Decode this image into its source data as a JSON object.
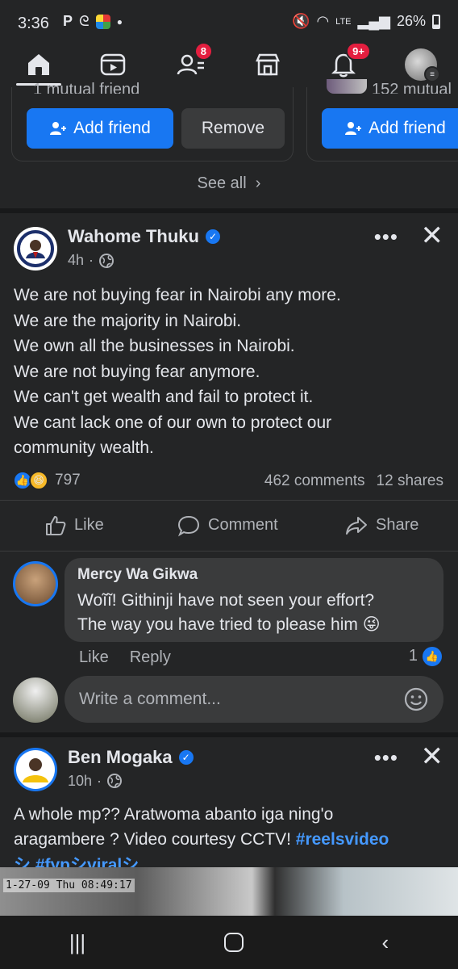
{
  "status_bar": {
    "time": "3:36",
    "left_glyphs": "P",
    "network": "LTE",
    "battery": "26%"
  },
  "nav": {
    "friends_badge": "8",
    "notifications_badge": "9+"
  },
  "suggestions": {
    "left_mutual": "1 mutual friend",
    "right_mutual": "152 mutual",
    "add_friend_label": "Add friend",
    "remove_label": "Remove",
    "see_all": "See all"
  },
  "post1": {
    "author": "Wahome Thuku",
    "time": "4h",
    "text_lines": [
      "We are not buying fear in Nairobi any more.",
      "We are the majority in Nairobi.",
      "We own all the businesses in Nairobi.",
      "We are not buying fear anymore.",
      "We can't get wealth and fail to protect it.",
      "We cant lack one of our own to protect our",
      "community wealth."
    ],
    "reaction_count": "797",
    "comments": "462 comments",
    "shares": "12 shares",
    "like_label": "Like",
    "comment_label": "Comment",
    "share_label": "Share",
    "avatar_text": "WAHOME THUKU MEDIA"
  },
  "comment": {
    "author": "Mercy Wa Gikwa",
    "line1": "Woĩĩ! Githinji have not seen your effort?",
    "line2": "The way you have tried to please him 😜",
    "like": "Like",
    "reply": "Reply",
    "likes": "1"
  },
  "write_comment": {
    "placeholder": "Write a comment..."
  },
  "post2": {
    "author": "Ben Mogaka",
    "time": "10h",
    "line1": "A whole mp?? Aratwoma abanto iga ning'o",
    "line2_plain": "aragambere ? Video courtesy CCTV! ",
    "line2_tag": "#reelsvideo",
    "line3": "シ #fypシviralシ",
    "video_timestamp": "1-27-09 Thu 08:49:17"
  }
}
